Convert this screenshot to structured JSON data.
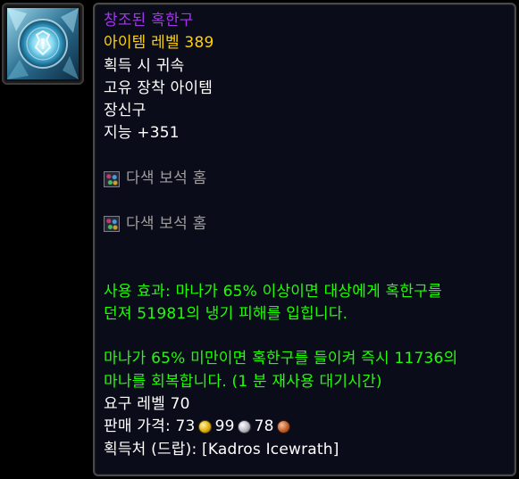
{
  "item_icon": "frost-orb-icon",
  "item": {
    "name": "창조된 혹한구",
    "level_label": "아이템 레벨",
    "level_value": "389",
    "binding": "획득 시 귀속",
    "unique": "고유 장착 아이템",
    "slot": "장신구",
    "stat": "지능 +351",
    "sockets": [
      {
        "label": "다색 보석 홈",
        "icon": "prismatic-socket-icon"
      },
      {
        "label": "다색 보석 홈",
        "icon": "prismatic-socket-icon"
      }
    ],
    "use_effect_lines": [
      "사용 효과: 마나가 65% 이상이면 대상에게 혹한구를",
      "던져 51981의 냉기 피해를 입힙니다."
    ],
    "secondary_effect_lines": [
      "마나가 65% 미만이면 혹한구를 들이켜 즉시 11736의",
      "마나를 회복합니다. (1 분 재사용 대기시간)"
    ],
    "required_level": "요구 레벨 70",
    "sell_price": {
      "label": "판매 가격:",
      "gold": "73",
      "silver": "99",
      "copper": "78"
    },
    "source": "획득처 (드랍): [Kadros Icewrath]"
  },
  "colors": {
    "epic": "#a335ee",
    "item_level": "#ffd100",
    "effect": "#1eff00",
    "socket_text": "#9d9d9d",
    "text": "#ffffff"
  }
}
